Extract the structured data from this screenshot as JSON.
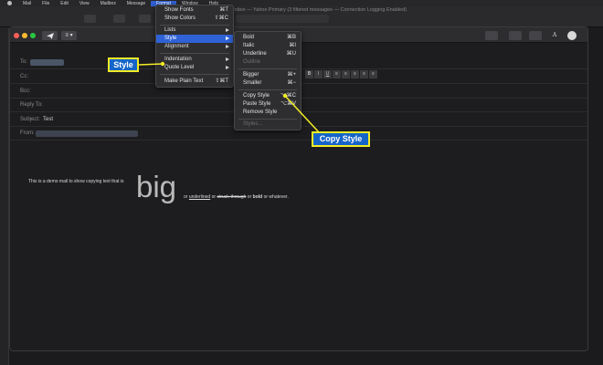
{
  "menubar": {
    "items": [
      "Mail",
      "File",
      "Edit",
      "View",
      "Mailbox",
      "Message",
      "Format",
      "Window",
      "Help"
    ],
    "active_index": 6
  },
  "window_title": "Inbox — Yahoo Primary (3 filtered messages — Connection Logging Enabled)",
  "compose": {
    "fields": [
      {
        "label": "To:",
        "value": ""
      },
      {
        "label": "Cc:",
        "value": ""
      },
      {
        "label": "Bcc:",
        "value": ""
      },
      {
        "label": "Reply To:",
        "value": ""
      },
      {
        "label": "Subject:",
        "value": "Test"
      },
      {
        "label": "From:",
        "value": ""
      }
    ],
    "font_size_select": "≡ ▾",
    "format_buttons": [
      "B",
      "I",
      "U",
      "≡",
      "≡",
      "≡",
      "≡",
      "≡"
    ],
    "body": {
      "before": "This is a demo mail to show copying text that is",
      "big": "big",
      "or1": "or",
      "underlined": "underlined",
      "mid": "or",
      "struck": "struck-through",
      "or2": "or",
      "bold": "bold",
      "after": "or whatever."
    }
  },
  "format_menu": {
    "items": [
      {
        "label": "Show Fonts",
        "shortcut": "⌘T"
      },
      {
        "label": "Show Colors",
        "shortcut": "⇧⌘C"
      },
      {
        "label": "Lists"
      },
      {
        "label": "Style"
      },
      {
        "label": "Alignment"
      },
      {
        "label": "Indentation"
      },
      {
        "label": "Quote Level"
      },
      {
        "label": "Make Plain Text",
        "shortcut": "⇧⌘T"
      }
    ]
  },
  "style_submenu": {
    "items": [
      {
        "label": "Bold",
        "shortcut": "⌘B"
      },
      {
        "label": "Italic",
        "shortcut": "⌘I"
      },
      {
        "label": "Underline",
        "shortcut": "⌘U"
      },
      {
        "label": "Outline",
        "shortcut": ""
      },
      {
        "label": "Bigger",
        "shortcut": "⌘+"
      },
      {
        "label": "Smaller",
        "shortcut": "⌘−"
      },
      {
        "label": "Copy Style",
        "shortcut": "⌥⌘C"
      },
      {
        "label": "Paste Style",
        "shortcut": "⌥⌘V"
      },
      {
        "label": "Remove Style",
        "shortcut": ""
      },
      {
        "label": "Styles...",
        "shortcut": ""
      }
    ]
  },
  "callouts": {
    "style": "Style",
    "copy_style": "Copy Style"
  },
  "colors": {
    "accent": "#2f62d6",
    "callout_fill": "#1565c8",
    "callout_border": "#f3ec26"
  }
}
